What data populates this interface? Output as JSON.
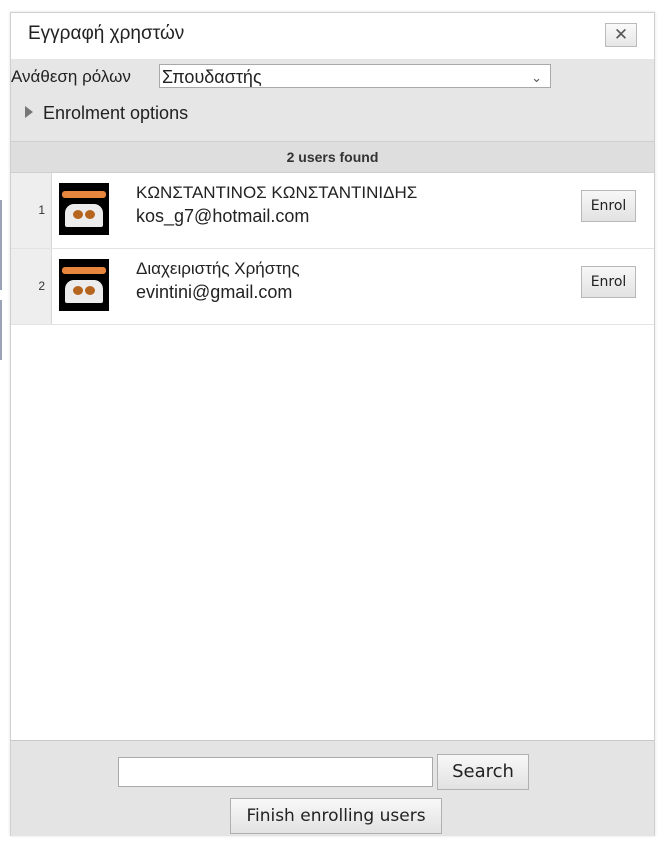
{
  "dialog": {
    "title": "Εγγραφή χρηστών",
    "close_symbol": "✕"
  },
  "role": {
    "label": "Ανάθεση ρόλων",
    "selected": "Σπουδαστής",
    "arrow_symbol": "⌄"
  },
  "enrolment_options": {
    "label": "Enrolment options"
  },
  "results": {
    "count_text": "2 users found",
    "users": [
      {
        "index": "1",
        "name": "ΚΩΝΣΤΑΝΤΙΝΟΣ ΚΩΝΣΤΑΝΤΙΝΙΔΗΣ",
        "email": "kos_g7@hotmail.com",
        "button": "Enrol"
      },
      {
        "index": "2",
        "name": "Διαχειριστής Χρήστης",
        "email": "evintini@gmail.com",
        "button": "Enrol"
      }
    ]
  },
  "footer": {
    "search_value": "",
    "search_button": "Search",
    "finish_button": "Finish enrolling users"
  },
  "colors": {
    "avatar_bar": "#e9863e",
    "avatar_bg": "#000000",
    "panel_bg": "#e6e6e6"
  }
}
